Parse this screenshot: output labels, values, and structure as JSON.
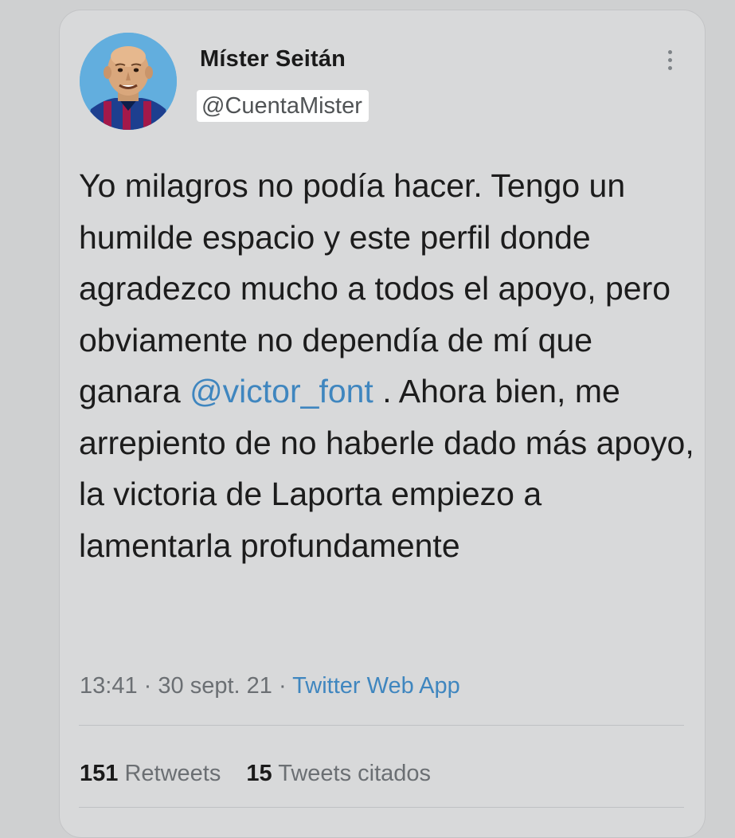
{
  "tweet": {
    "display_name": "Míster Seitán",
    "handle": "@CuentaMister",
    "text_parts": {
      "before_mention": "Yo milagros no podía hacer. Tengo un humilde espacio y este perfil donde agradezco mucho a todos el apoyo, pero obviamente no dependía de mí que ganara ",
      "mention": "@victor_font",
      "after_mention": " . Ahora bien, me arrepiento de no haberle dado más apoyo, la victoria de Laporta empiezo a lamentarla profundamente"
    },
    "time": "13:41",
    "separator": "·",
    "date": "30 sept. 21",
    "source": "Twitter Web App"
  },
  "stats": {
    "retweets_count": "151",
    "retweets_label": "Retweets",
    "quotes_count": "15",
    "quotes_label": "Tweets citados"
  },
  "icons": {
    "more": "more-vertical-icon",
    "avatar": "avatar"
  },
  "colors": {
    "link": "#3f86bf",
    "background": "#d8d9da"
  }
}
